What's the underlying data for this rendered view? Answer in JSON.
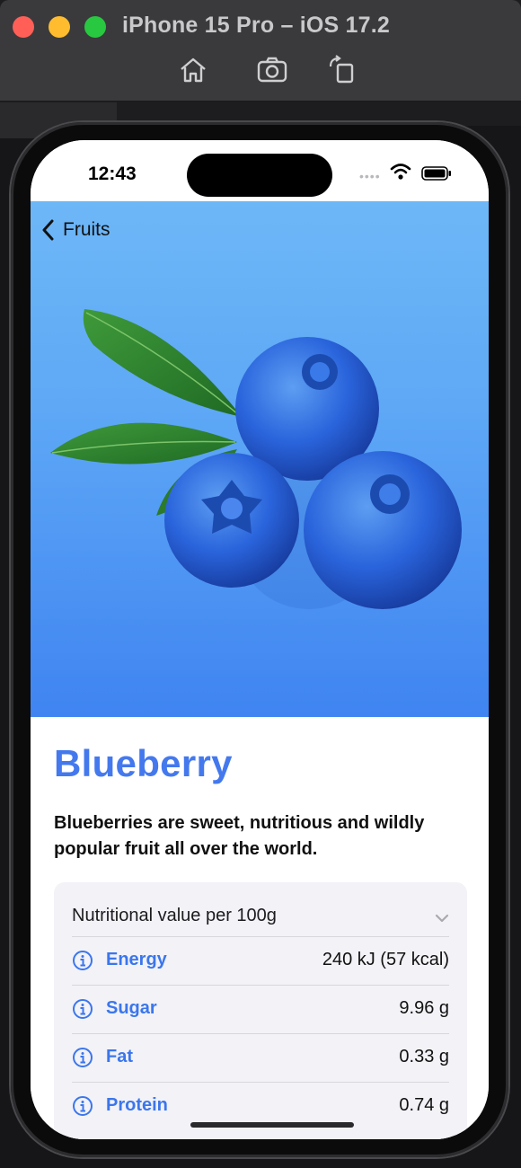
{
  "window": {
    "title": "iPhone 15 Pro – iOS 17.2"
  },
  "toolbar": {
    "home_icon": "home-icon",
    "screenshot_icon": "camera-icon",
    "rotate_icon": "rotate-icon"
  },
  "status_bar": {
    "time": "12:43"
  },
  "nav": {
    "back_label": "Fruits"
  },
  "fruit": {
    "name": "Blueberry",
    "description": "Blueberries are sweet, nutritious and wildly popular fruit all over the world.",
    "hero_gradient": [
      "#6db7f7",
      "#3f84f1"
    ]
  },
  "nutrition": {
    "header": "Nutritional value per 100g",
    "rows": [
      {
        "name": "Energy",
        "value": "240 kJ (57 kcal)"
      },
      {
        "name": "Sugar",
        "value": "9.96 g"
      },
      {
        "name": "Fat",
        "value": "0.33 g"
      },
      {
        "name": "Protein",
        "value": "0.74 g"
      }
    ]
  },
  "colors": {
    "accent": "#3b76ec",
    "title": "#4479ee",
    "card_bg": "#f2f2f7"
  }
}
